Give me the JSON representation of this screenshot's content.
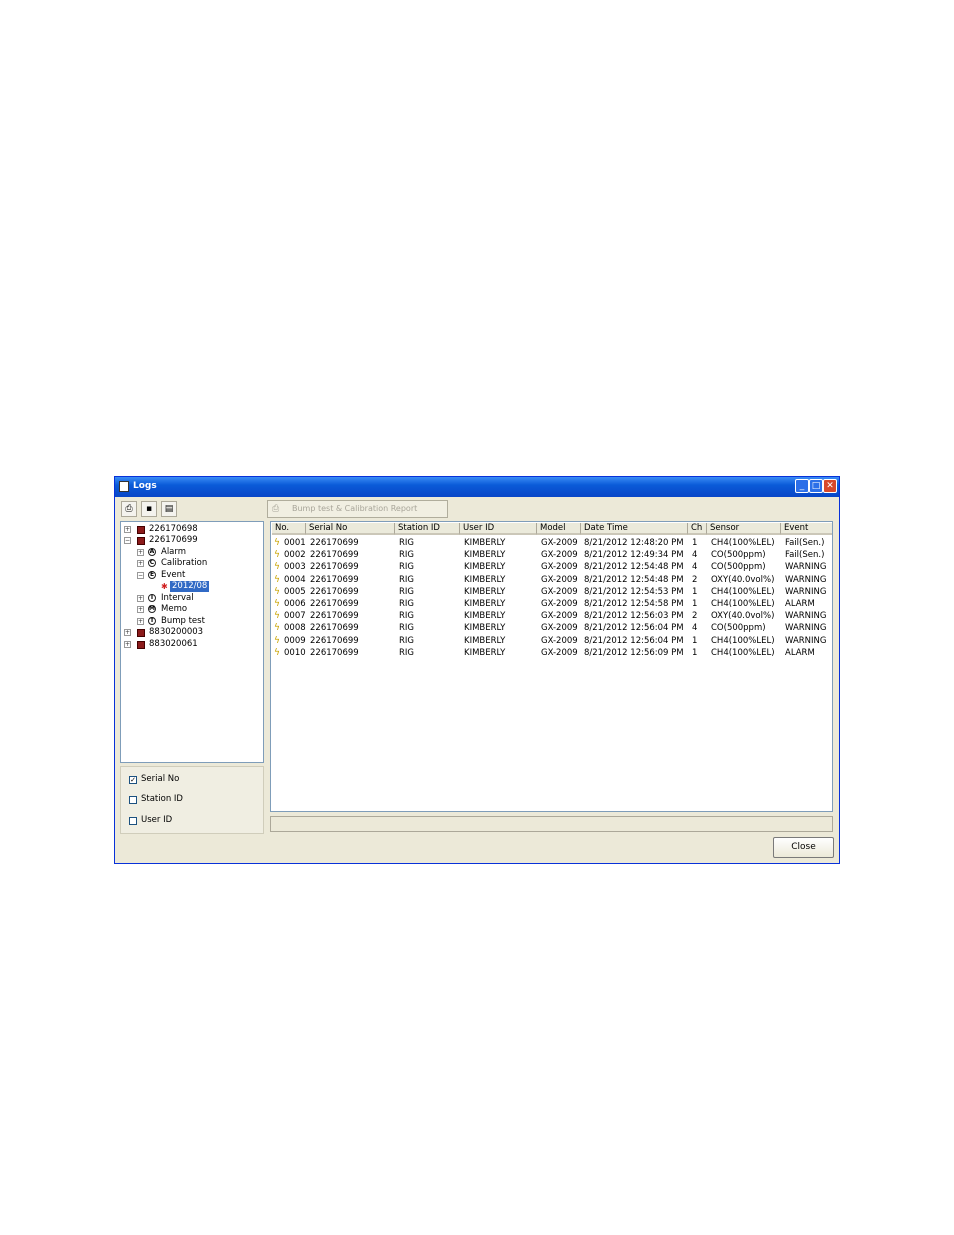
{
  "window": {
    "title": "Logs"
  },
  "toolbar": {
    "report_button_label": "Bump test & Calibration Report"
  },
  "tree": {
    "nodes": [
      {
        "label": "226170698"
      },
      {
        "label": "226170699"
      },
      {
        "label": "Alarm",
        "badge": "A"
      },
      {
        "label": "Calibration",
        "badge": "C"
      },
      {
        "label": "Event",
        "badge": "E"
      },
      {
        "label": "2012/08"
      },
      {
        "label": "Interval",
        "badge": "I"
      },
      {
        "label": "Memo",
        "badge": "M"
      },
      {
        "label": "Bump test",
        "badge": "T"
      },
      {
        "label": "8830200003"
      },
      {
        "label": "883020061"
      }
    ]
  },
  "filters": {
    "serial_no": {
      "label": "Serial No",
      "checked": true
    },
    "station_id": {
      "label": "Station ID",
      "checked": false
    },
    "user_id": {
      "label": "User ID",
      "checked": false
    }
  },
  "table": {
    "headers": [
      "No.",
      "Serial No",
      "Station ID",
      "User ID",
      "Model",
      "Date Time",
      "Ch",
      "Sensor",
      "Event"
    ],
    "rows": [
      [
        "0001",
        "226170699",
        "RIG",
        "KIMBERLY",
        "GX-2009",
        "8/21/2012 12:48:20 PM",
        "1",
        "CH4(100%LEL)",
        "Fail(Sen.)"
      ],
      [
        "0002",
        "226170699",
        "RIG",
        "KIMBERLY",
        "GX-2009",
        "8/21/2012 12:49:34 PM",
        "4",
        "CO(500ppm)",
        "Fail(Sen.)"
      ],
      [
        "0003",
        "226170699",
        "RIG",
        "KIMBERLY",
        "GX-2009",
        "8/21/2012 12:54:48 PM",
        "4",
        "CO(500ppm)",
        "WARNING"
      ],
      [
        "0004",
        "226170699",
        "RIG",
        "KIMBERLY",
        "GX-2009",
        "8/21/2012 12:54:48 PM",
        "2",
        "OXY(40.0vol%)",
        "WARNING"
      ],
      [
        "0005",
        "226170699",
        "RIG",
        "KIMBERLY",
        "GX-2009",
        "8/21/2012 12:54:53 PM",
        "1",
        "CH4(100%LEL)",
        "WARNING"
      ],
      [
        "0006",
        "226170699",
        "RIG",
        "KIMBERLY",
        "GX-2009",
        "8/21/2012 12:54:58 PM",
        "1",
        "CH4(100%LEL)",
        "ALARM"
      ],
      [
        "0007",
        "226170699",
        "RIG",
        "KIMBERLY",
        "GX-2009",
        "8/21/2012 12:56:03 PM",
        "2",
        "OXY(40.0vol%)",
        "WARNING"
      ],
      [
        "0008",
        "226170699",
        "RIG",
        "KIMBERLY",
        "GX-2009",
        "8/21/2012 12:56:04 PM",
        "4",
        "CO(500ppm)",
        "WARNING"
      ],
      [
        "0009",
        "226170699",
        "RIG",
        "KIMBERLY",
        "GX-2009",
        "8/21/2012 12:56:04 PM",
        "1",
        "CH4(100%LEL)",
        "WARNING"
      ],
      [
        "0010",
        "226170699",
        "RIG",
        "KIMBERLY",
        "GX-2009",
        "8/21/2012 12:56:09 PM",
        "1",
        "CH4(100%LEL)",
        "ALARM"
      ]
    ]
  },
  "footer": {
    "close_label": "Close"
  },
  "colors": {
    "title_bar": "#0a5bd8",
    "selection": "#316ac5",
    "dialog_bg": "#ece9d8"
  }
}
